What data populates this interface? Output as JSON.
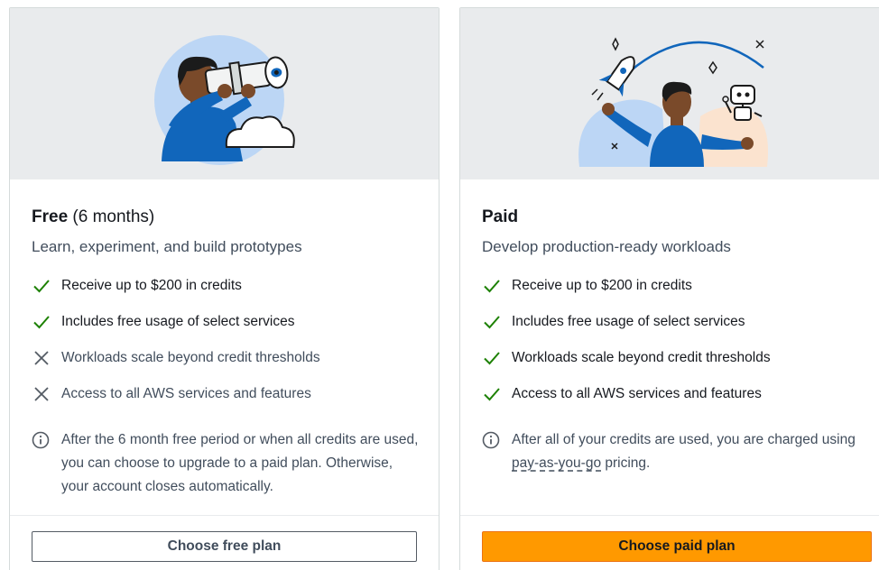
{
  "colors": {
    "accent_orange": "#ff9900",
    "check_green": "#1d8102",
    "muted_gray": "#545b64",
    "hero_bg": "#e9ebed",
    "figure_blue": "#1166bb"
  },
  "plans": {
    "free": {
      "title": "Free",
      "title_suffix": " (6 months)",
      "subtitle": "Learn, experiment, and build prototypes",
      "features": [
        {
          "label": "Receive up to $200 in credits",
          "included": true,
          "icon": "check-icon"
        },
        {
          "label": "Includes free usage of select services",
          "included": true,
          "icon": "check-icon"
        },
        {
          "label": "Workloads scale beyond credit thresholds",
          "included": false,
          "icon": "x-icon"
        },
        {
          "label": "Access to all AWS services and features",
          "included": false,
          "icon": "x-icon"
        }
      ],
      "info": {
        "icon": "info-icon",
        "text": "After the 6 month free period or when all credits are used, you can choose to upgrade to a paid plan. Otherwise, your account closes automatically."
      },
      "button_label": "Choose free plan",
      "illustration": "person-with-telescope-illustration"
    },
    "paid": {
      "title": "Paid",
      "subtitle": "Develop production-ready workloads",
      "features": [
        {
          "label": "Receive up to $200 in credits",
          "included": true,
          "icon": "check-icon"
        },
        {
          "label": "Includes free usage of select services",
          "included": true,
          "icon": "check-icon"
        },
        {
          "label": "Workloads scale beyond credit thresholds",
          "included": true,
          "icon": "check-icon"
        },
        {
          "label": "Access to all AWS services and features",
          "included": true,
          "icon": "check-icon"
        }
      ],
      "info": {
        "icon": "info-icon",
        "text_before": "After all of your credits are used, you are charged using ",
        "link_text": "pay-as-you-go",
        "text_after": " pricing."
      },
      "button_label": "Choose paid plan",
      "illustration": "person-with-rocket-and-robot-illustration"
    }
  }
}
